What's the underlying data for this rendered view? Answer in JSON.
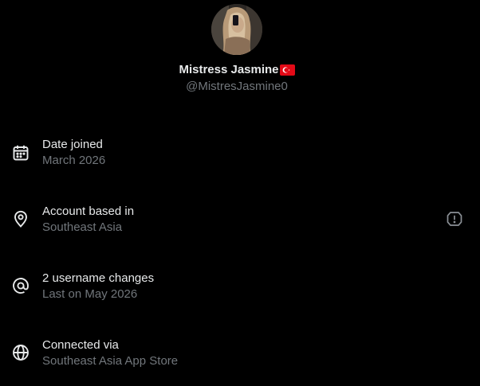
{
  "profile": {
    "display_name": "Mistress Jasmine",
    "flag_icon": "turkey-flag-icon",
    "handle": "@MistresJasmine0",
    "avatar": "profile-avatar"
  },
  "details": [
    {
      "icon": "calendar-icon",
      "title": "Date joined",
      "subtitle": "March 2026"
    },
    {
      "icon": "location-pin-icon",
      "title": "Account based in",
      "subtitle": "Southeast Asia",
      "side_icon": "shield-alert-icon"
    },
    {
      "icon": "at-sign-icon",
      "title": "2 username changes",
      "subtitle": "Last on May 2026"
    },
    {
      "icon": "globe-icon",
      "title": "Connected via",
      "subtitle": "Southeast Asia App Store"
    }
  ],
  "colors": {
    "background": "#000000",
    "primary_text": "#e7e9ea",
    "secondary_text": "#71767b",
    "flag_red": "#e30a17"
  }
}
